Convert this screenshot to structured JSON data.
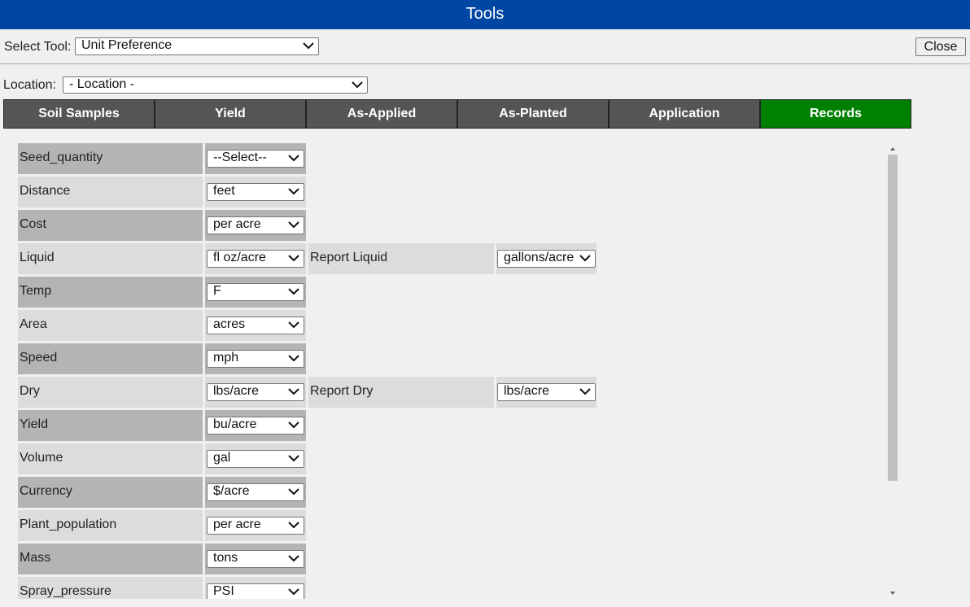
{
  "window": {
    "title": "Tools",
    "close_label": "Close"
  },
  "tool_select": {
    "label": "Select Tool:",
    "value": "Unit Preference"
  },
  "location_select": {
    "label": "Location:",
    "value": "- Location -"
  },
  "tabs": [
    {
      "label": "Soil Samples",
      "active": false
    },
    {
      "label": "Yield",
      "active": false
    },
    {
      "label": "As-Applied",
      "active": false
    },
    {
      "label": "As-Planted",
      "active": false
    },
    {
      "label": "Application",
      "active": false
    },
    {
      "label": "Records",
      "active": true
    }
  ],
  "preferences": [
    {
      "label": "Seed_quantity",
      "value": "--Select--"
    },
    {
      "label": "Distance",
      "value": "feet"
    },
    {
      "label": "Cost",
      "value": "per acre"
    },
    {
      "label": "Liquid",
      "value": "fl oz/acre",
      "report_label": "Report Liquid",
      "report_value": "gallons/acre"
    },
    {
      "label": "Temp",
      "value": "F"
    },
    {
      "label": "Area",
      "value": "acres"
    },
    {
      "label": "Speed",
      "value": "mph"
    },
    {
      "label": "Dry",
      "value": "lbs/acre",
      "report_label": "Report Dry",
      "report_value": "lbs/acre"
    },
    {
      "label": "Yield",
      "value": "bu/acre"
    },
    {
      "label": "Volume",
      "value": "gal"
    },
    {
      "label": "Currency",
      "value": "$/acre"
    },
    {
      "label": "Plant_population",
      "value": "per acre"
    },
    {
      "label": "Mass",
      "value": "tons"
    },
    {
      "label": "Spray_pressure",
      "value": "PSI"
    }
  ],
  "colors": {
    "title_bar": "#0047a3",
    "tab": "#555555",
    "tab_active": "#008000",
    "row_dark": "#b4b4b4",
    "row_light": "#dcdcdc"
  }
}
